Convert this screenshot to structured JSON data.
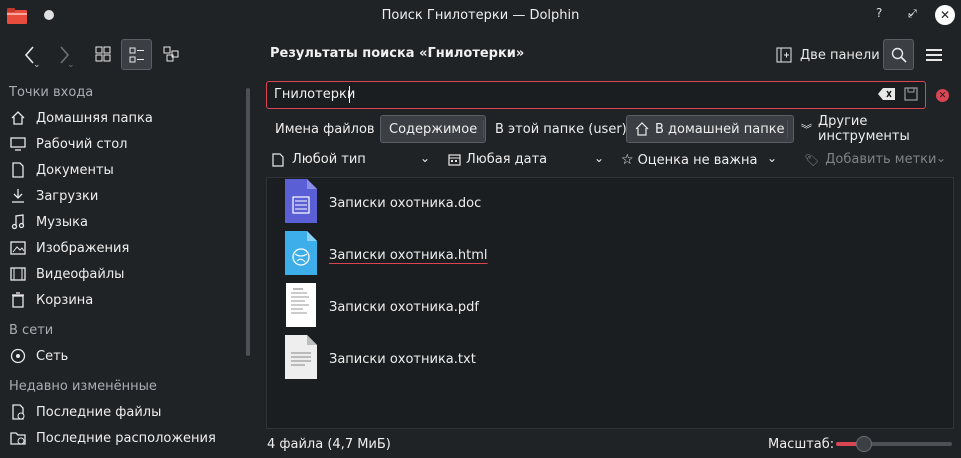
{
  "window": {
    "title": "Поиск Гнилотерки — Dolphin"
  },
  "toolbar": {
    "location": "Результаты поиска «Гнилотерки»",
    "split_label": "Две панели"
  },
  "sidebar": {
    "sections": [
      {
        "title": "Точки входа",
        "items": [
          "Домашняя папка",
          "Рабочий стол",
          "Документы",
          "Загрузки",
          "Музыка",
          "Изображения",
          "Видеофайлы",
          "Корзина"
        ]
      },
      {
        "title": "В сети",
        "items": [
          "Сеть"
        ]
      },
      {
        "title": "Недавно изменённые",
        "items": [
          "Последние файлы",
          "Последние расположения"
        ]
      }
    ]
  },
  "search": {
    "query": "Гнилотерки",
    "scope_what": [
      "Имена файлов",
      "Содержимое"
    ],
    "scope_where": [
      "В этой папке (user)",
      "В домашней папке"
    ],
    "more_tools": "Другие инструменты",
    "filters": {
      "type": "Любой тип",
      "date": "Любая дата",
      "rating": "Оценка не важна",
      "tags": "Добавить метки"
    }
  },
  "files": [
    {
      "name": "Записки охотника.doc",
      "icon": "doc-file-icon"
    },
    {
      "name": "Записки охотника.html",
      "icon": "html-file-icon"
    },
    {
      "name": "Записки охотника.pdf",
      "icon": "pdf-file-icon"
    },
    {
      "name": "Записки охотника.txt",
      "icon": "txt-file-icon"
    }
  ],
  "status": {
    "summary": "4 файла (4,7 МиБ)",
    "zoom_label": "Масштаб:",
    "zoom_level": 0.2
  },
  "colors": {
    "accent": "#da4453",
    "doc": "#5b5fd6",
    "html": "#3daee9"
  }
}
